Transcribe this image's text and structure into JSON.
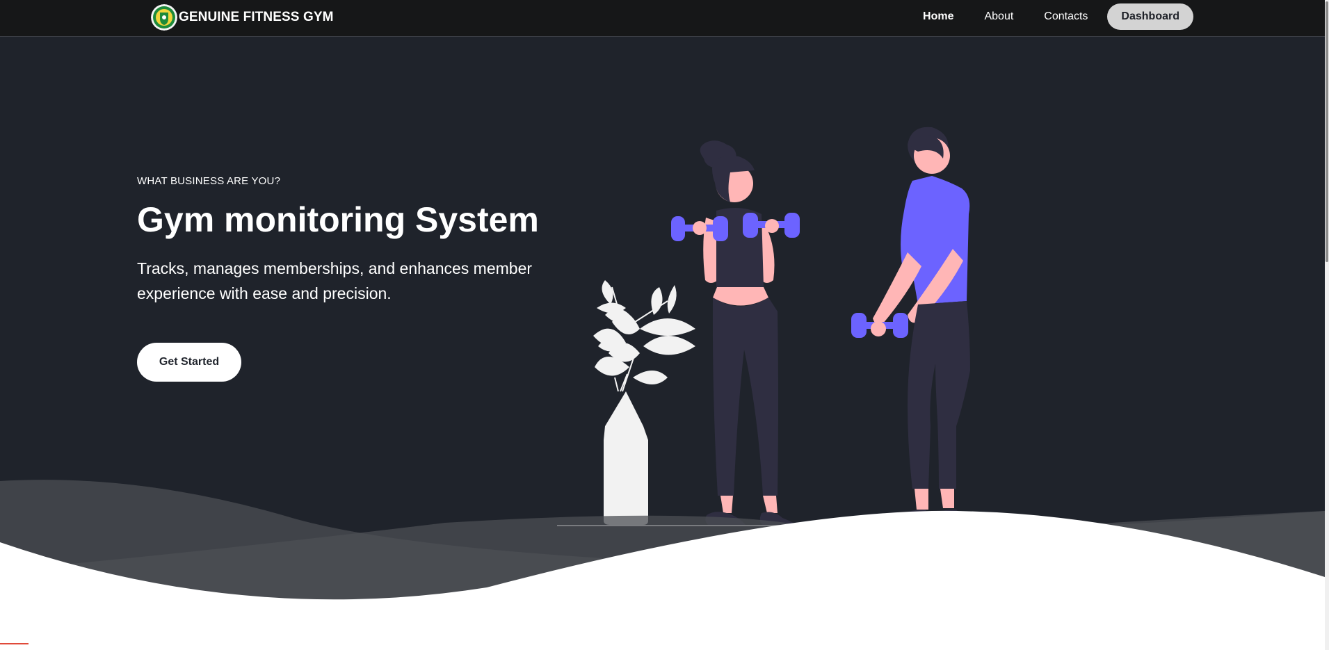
{
  "nav": {
    "brand": "GENUINE FITNESS GYM",
    "links": [
      "Home",
      "About",
      "Contacts"
    ],
    "active": "Home",
    "dashboard": "Dashboard"
  },
  "hero": {
    "eyebrow": "WHAT BUSINESS ARE YOU?",
    "title": "Gym monitoring System",
    "description": "Tracks, manages memberships, and enhances member experience with ease and precision.",
    "cta": "Get Started"
  },
  "colors": {
    "nav_bg": "#161718",
    "hero_bg": "#1f232b",
    "accent": "#6c63ff",
    "skin": "#ffb6b6",
    "clothing": "#2f2e41",
    "plant": "#f2f2f2",
    "button_bg": "#ffffff"
  },
  "icons": {
    "logo": "gym-seal-logo"
  }
}
